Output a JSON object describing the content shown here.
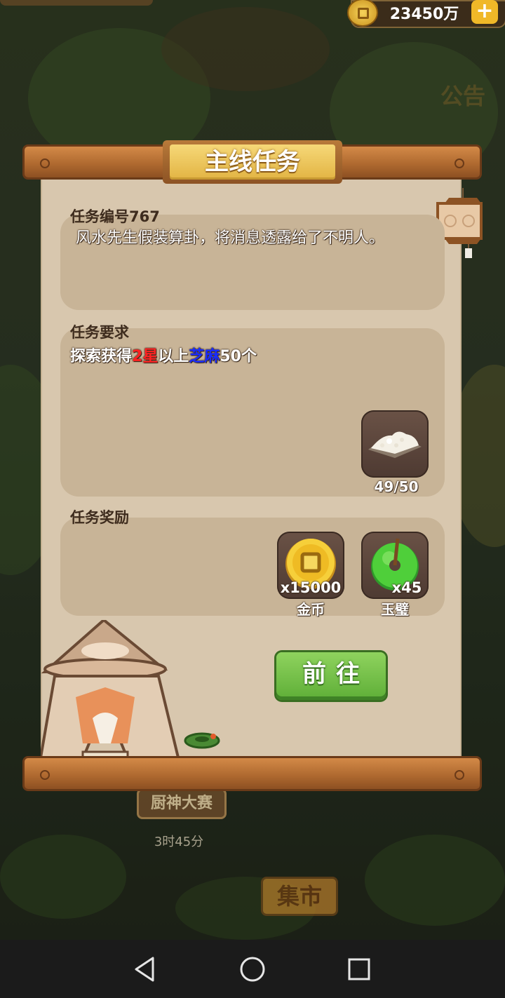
{
  "header": {
    "coin_amount": "23450万",
    "coin_plus": "+"
  },
  "modal": {
    "title": "主线任务",
    "task_number_label": "任务编号767",
    "task_description": "风水先生假装算卦，将消息透露给了不明人。",
    "requirement_label": "任务要求",
    "requirement": {
      "prefix": "探索获得",
      "star_text": "2星",
      "middle": "以上",
      "item_text": "芝麻",
      "suffix": "50个"
    },
    "requirement_item": {
      "icon": "sesame-pile-icon",
      "progress": "49/50",
      "current": 49,
      "target": 50
    },
    "reward_label": "任务奖励",
    "rewards": [
      {
        "icon": "gold-coin-icon",
        "qty": "x15000",
        "name": "金币"
      },
      {
        "icon": "jade-bi-icon",
        "qty": "x45",
        "name": "玉璧"
      }
    ],
    "go_button": "前往"
  },
  "background": {
    "chef_contest_sign": "厨神大赛",
    "chef_contest_timer": "3时45分",
    "market_sign": "集市",
    "notice_label": "公告"
  },
  "navbar": {
    "back_icon": "back-triangle-icon",
    "home_icon": "home-circle-icon",
    "recent_icon": "recent-square-icon"
  },
  "colors": {
    "star_red": "#ff2222",
    "item_blue": "#1a2cff",
    "go_green": "#5eae37",
    "title_gold": "#e2b443"
  }
}
